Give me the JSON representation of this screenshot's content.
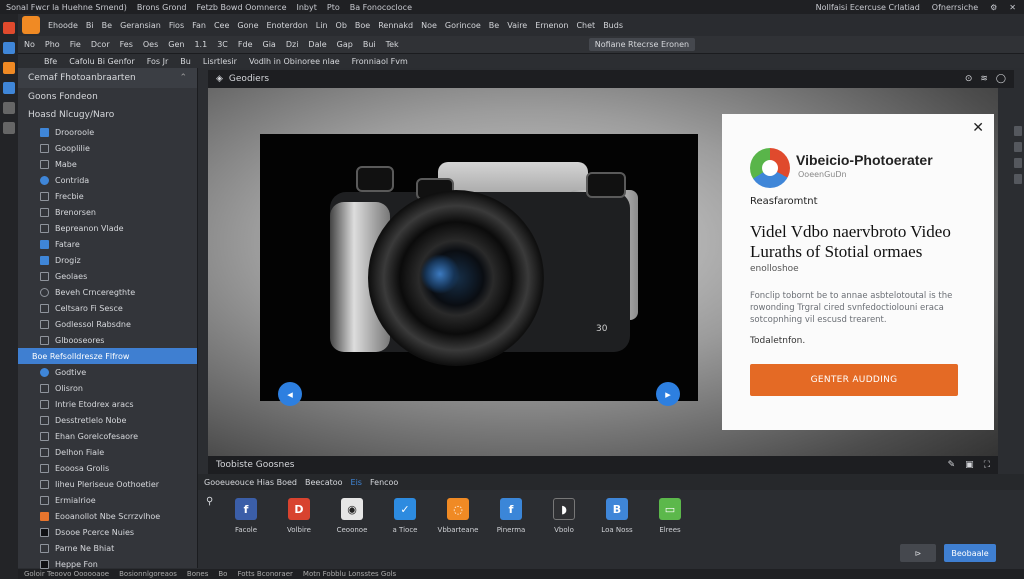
{
  "topbar": {
    "items": [
      "Sonal Fwcr la Huehne Srnend)",
      "Brons Grond",
      "Fetzb Bowd Oomnerce",
      "Inbyt",
      "Pto",
      "Ba Fonococloce"
    ],
    "right": [
      "Nollfaisi Ecercuse Crlatiad",
      "Ofnerrsiche"
    ]
  },
  "menubar": {
    "items": [
      "Ehoode",
      "Bi",
      "Be",
      "Geransian",
      "Fios",
      "Fan",
      "Cee",
      "Gone",
      "Enoterdon",
      "Lin",
      "Ob",
      "Boe",
      "Rennakd",
      "Noe",
      "Gorincoe",
      "Be",
      "Vaire",
      "Ernenon",
      "Chet",
      "Buds"
    ]
  },
  "toolbar": {
    "items": [
      "No",
      "Pho",
      "Fie",
      "Dcor",
      "Fes",
      "Oes",
      "Gen",
      "1.1",
      "3C",
      "Fde",
      "Gia",
      "Dzi",
      "Dale",
      "Gap",
      "Bui",
      "Tek"
    ],
    "field": "Nofiane Rtecrse Eronen"
  },
  "subbar": {
    "items": [
      "Bfe",
      "Cafolu Bi Genfor",
      "Fos Jr",
      "Bu",
      "Lisrtlesir",
      "Vodlh in Obinoree nlae",
      "Fronniaol Fvm"
    ]
  },
  "sidebar": {
    "header": "Cemaf Fhotoanbraarten",
    "section": "Goons  Fondeon",
    "group": "Hoasd Nlcugy/Naro",
    "items": [
      "Drooroole",
      "Gooplilie",
      "Mabe",
      "Contrida",
      "Frecbie",
      "Brenorsen",
      "Bepreanon Vlade",
      "Fatare",
      "Drogiz",
      "Geolaes",
      "Beveh Crnceregthte",
      "Celtsaro Fi Sesce",
      "Godlessol Rabsdne",
      "Glbooseores"
    ],
    "selected": "Boe Refsolldresze Flfrow",
    "items2": [
      "Godtive",
      "Olisron",
      "Intrie Etodrex aracs",
      "Desstretlelo Nobe",
      "Ehan Gorelcofesaore",
      "Delhon Fiale",
      "Eooosa Grolis",
      "Iiheu Pleriseue Oothoetier",
      "Ermialrioe",
      "Eooanollot Nbe Scrrzvlhoe",
      "Dsooe Pcerce Nuies",
      "Parne Ne Bhiat",
      "Heppe Fon"
    ]
  },
  "preview": {
    "title": "Geodiers",
    "footer": "Toobiste  Goosnes",
    "camera_label": "30"
  },
  "dialog": {
    "brand": "Vibeicio-Photoerater",
    "brand_sub": "OoeenGuDn",
    "section": "Reasfaromtnt",
    "headline": "Videl Vdbo naervbroto Video Luraths of Stotial ormaes",
    "headline_sub": "enolloshoe",
    "body": "Fonclip tobornt be to annae asbtelotoutal is the rowonding Trgral cired svnfedoctiolouni eraca sotcopnhing vil escusd trearent.",
    "link": "Todaletnfon.",
    "cta": "GENTER AUDDING"
  },
  "share": {
    "tabs": [
      "Gooeueouce Hias Boed",
      "Beecatoo",
      "Eis",
      "Fencoo"
    ],
    "items": [
      {
        "label": "Facole",
        "icon": "facebook-icon",
        "glyph": "f",
        "color": "#3b5ea8"
      },
      {
        "label": "Volbire",
        "icon": "flag-icon",
        "glyph": "D",
        "color": "#d8432f"
      },
      {
        "label": "Ceoonoe",
        "icon": "camera-icon",
        "glyph": "◉",
        "color": "#e6e6e6"
      },
      {
        "label": "a Tioce",
        "icon": "twitter-icon",
        "glyph": "✓",
        "color": "#2d8be0"
      },
      {
        "label": "Vbbarteane",
        "icon": "chat-icon",
        "glyph": "◌",
        "color": "#f08a24"
      },
      {
        "label": "Pinerma",
        "icon": "share-icon",
        "glyph": "f",
        "color": "#3b86d8"
      },
      {
        "label": "Vbolo",
        "icon": "video-icon",
        "glyph": "◗",
        "color": "#2f3033"
      },
      {
        "label": "Loa Noss",
        "icon": "blog-icon",
        "glyph": "B",
        "color": "#3f86d8"
      },
      {
        "label": "Elrees",
        "icon": "image-icon",
        "glyph": "▭",
        "color": "#5cb84b"
      }
    ],
    "back": "⊳",
    "next": "Beobaale"
  },
  "statusbar": {
    "items": [
      "Goloir Teoovo Oooooaoe",
      "Bosionnlgoreaos",
      "Bones",
      "Bo",
      "Fotts Bconoraer",
      "Motn Fobblu Lonsstes Gols"
    ]
  }
}
